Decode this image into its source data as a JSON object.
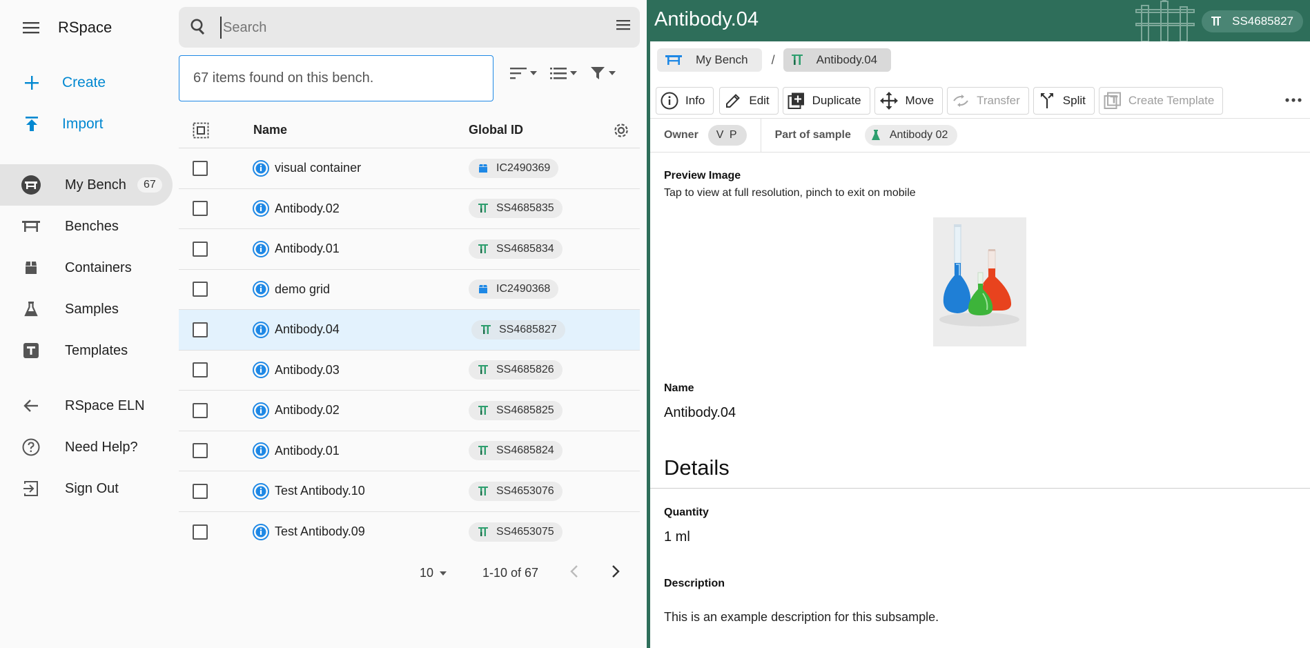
{
  "app": {
    "name": "RSpace"
  },
  "sidebar": {
    "actions": [
      {
        "label": "Create",
        "icon": "plus-icon"
      },
      {
        "label": "Import",
        "icon": "upload-icon"
      }
    ],
    "nav": [
      {
        "label": "My Bench",
        "icon": "bench-icon",
        "badge": "67",
        "active": true
      },
      {
        "label": "Benches",
        "icon": "benches-icon"
      },
      {
        "label": "Containers",
        "icon": "container-icon"
      },
      {
        "label": "Samples",
        "icon": "flask-icon"
      },
      {
        "label": "Templates",
        "icon": "template-icon"
      }
    ],
    "footer": [
      {
        "label": "RSpace ELN",
        "icon": "arrow-left-icon"
      },
      {
        "label": "Need Help?",
        "icon": "help-icon"
      },
      {
        "label": "Sign Out",
        "icon": "sign-out-icon"
      }
    ]
  },
  "search": {
    "placeholder": "Search"
  },
  "list": {
    "results_text": "67 items found on this bench.",
    "columns": {
      "name": "Name",
      "global_id": "Global ID"
    },
    "rows": [
      {
        "name": "visual container",
        "global_id": "IC2490369",
        "type": "container"
      },
      {
        "name": "Antibody.02",
        "global_id": "SS4685835",
        "type": "subsample"
      },
      {
        "name": "Antibody.01",
        "global_id": "SS4685834",
        "type": "subsample"
      },
      {
        "name": "demo grid",
        "global_id": "IC2490368",
        "type": "container"
      },
      {
        "name": "Antibody.04",
        "global_id": "SS4685827",
        "type": "subsample",
        "selected": true
      },
      {
        "name": "Antibody.03",
        "global_id": "SS4685826",
        "type": "subsample"
      },
      {
        "name": "Antibody.02",
        "global_id": "SS4685825",
        "type": "subsample"
      },
      {
        "name": "Antibody.01",
        "global_id": "SS4685824",
        "type": "subsample"
      },
      {
        "name": "Test Antibody.10",
        "global_id": "SS4653076",
        "type": "subsample"
      },
      {
        "name": "Test Antibody.09",
        "global_id": "SS4653075",
        "type": "subsample"
      }
    ],
    "pagination": {
      "page_size": "10",
      "range": "1-10 of 67"
    }
  },
  "detail": {
    "title": "Antibody.04",
    "global_id": "SS4685827",
    "breadcrumbs": [
      {
        "label": "My Bench",
        "icon": "bench-icon"
      },
      {
        "label": "Antibody.04",
        "icon": "subsample-icon"
      }
    ],
    "breadcrumb_separator": "/",
    "actions": [
      {
        "label": "Info",
        "icon": "info-icon",
        "enabled": true
      },
      {
        "label": "Edit",
        "icon": "pencil-icon",
        "enabled": true
      },
      {
        "label": "Duplicate",
        "icon": "duplicate-icon",
        "enabled": true
      },
      {
        "label": "Move",
        "icon": "move-icon",
        "enabled": true
      },
      {
        "label": "Transfer",
        "icon": "transfer-icon",
        "enabled": false
      },
      {
        "label": "Split",
        "icon": "split-icon",
        "enabled": true
      },
      {
        "label": "Create Template",
        "icon": "template-icon",
        "enabled": false
      }
    ],
    "owner_label": "Owner",
    "owner": "V P",
    "part_of_label": "Part of sample",
    "part_of": "Antibody 02",
    "preview": {
      "label": "Preview Image",
      "hint": "Tap to view at full resolution, pinch to exit on mobile"
    },
    "name_label": "Name",
    "name": "Antibody.04",
    "details_heading": "Details",
    "quantity_label": "Quantity",
    "quantity": "1 ml",
    "description_label": "Description",
    "description": "This is an example description for this subsample."
  },
  "colors": {
    "accent": "#0288d1",
    "header_green": "#2e6e5a",
    "info_blue": "#1e88e5",
    "subsample_green": "#2e9e6e",
    "container_blue": "#1e88e5"
  }
}
